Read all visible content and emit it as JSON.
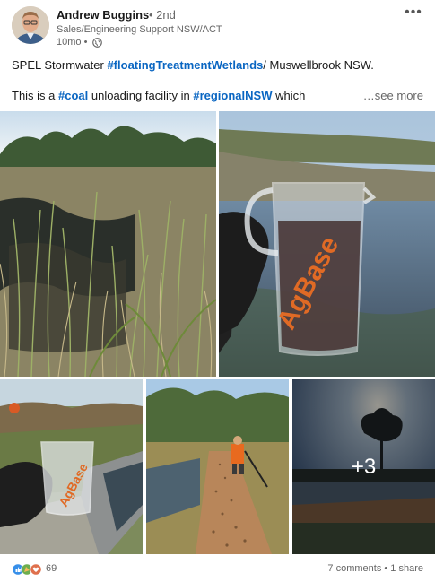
{
  "author": {
    "name": "Andrew Buggins",
    "degree": "• 2nd",
    "headline": "Sales/Engineering Support NSW/ACT",
    "timestamp": "10mo •",
    "visibility_icon": "globe-icon"
  },
  "menu_icon": "more-options-icon",
  "post": {
    "line1_a": "SPEL Stormwater ",
    "line1_tag": "#floatingTreatmentWetlands",
    "line1_b": "/ Muswellbrook NSW.",
    "line2_a": "This is a ",
    "line2_tag1": "#coal",
    "line2_b": " unloading facility in ",
    "line2_tag2": "#regionalNSW",
    "line2_c": " which",
    "see_more": "…see more"
  },
  "photos": {
    "cup_brand": "AgBase",
    "more_count": "+3"
  },
  "footer": {
    "reaction_icons": [
      "like-icon",
      "celebrate-icon",
      "love-icon"
    ],
    "reaction_count": "69",
    "comments": "7 comments",
    "shares": "1 share",
    "separator": " • "
  },
  "colors": {
    "link": "#0a66c2",
    "secondary_text": "#666666"
  }
}
